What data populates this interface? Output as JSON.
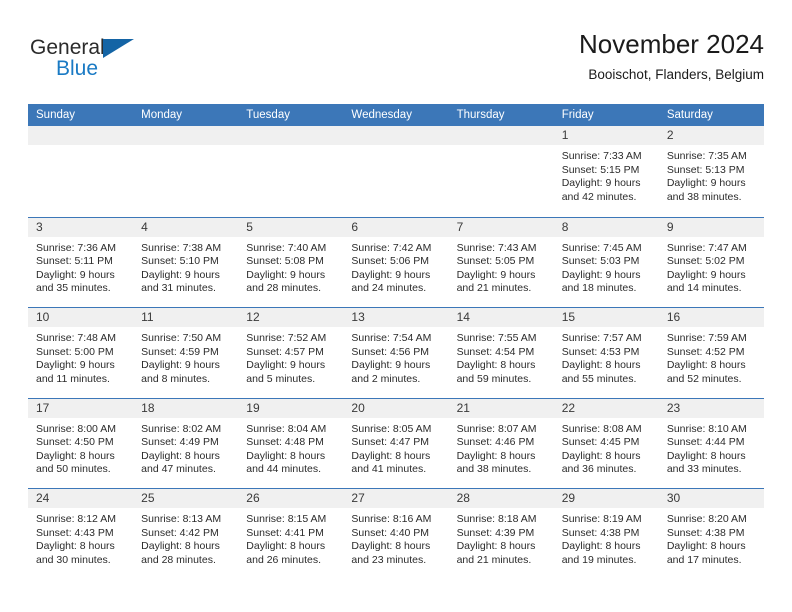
{
  "brand": {
    "name_part1": "General",
    "name_part2": "Blue",
    "triangle_color": "#1464a5",
    "blue_color": "#1a7ac4"
  },
  "header": {
    "title": "November 2024",
    "subtitle": "Booischot, Flanders, Belgium"
  },
  "theme": {
    "header_band": "#3c77b8",
    "daynum_band": "#f0f0f0",
    "row_divider": "#3c77b8",
    "text": "#2b2b2b"
  },
  "weekdays": [
    "Sunday",
    "Monday",
    "Tuesday",
    "Wednesday",
    "Thursday",
    "Friday",
    "Saturday"
  ],
  "weeks": [
    [
      {
        "day": "",
        "lines": []
      },
      {
        "day": "",
        "lines": []
      },
      {
        "day": "",
        "lines": []
      },
      {
        "day": "",
        "lines": []
      },
      {
        "day": "",
        "lines": []
      },
      {
        "day": "1",
        "lines": [
          "Sunrise: 7:33 AM",
          "Sunset: 5:15 PM",
          "Daylight: 9 hours",
          "and 42 minutes."
        ]
      },
      {
        "day": "2",
        "lines": [
          "Sunrise: 7:35 AM",
          "Sunset: 5:13 PM",
          "Daylight: 9 hours",
          "and 38 minutes."
        ]
      }
    ],
    [
      {
        "day": "3",
        "lines": [
          "Sunrise: 7:36 AM",
          "Sunset: 5:11 PM",
          "Daylight: 9 hours",
          "and 35 minutes."
        ]
      },
      {
        "day": "4",
        "lines": [
          "Sunrise: 7:38 AM",
          "Sunset: 5:10 PM",
          "Daylight: 9 hours",
          "and 31 minutes."
        ]
      },
      {
        "day": "5",
        "lines": [
          "Sunrise: 7:40 AM",
          "Sunset: 5:08 PM",
          "Daylight: 9 hours",
          "and 28 minutes."
        ]
      },
      {
        "day": "6",
        "lines": [
          "Sunrise: 7:42 AM",
          "Sunset: 5:06 PM",
          "Daylight: 9 hours",
          "and 24 minutes."
        ]
      },
      {
        "day": "7",
        "lines": [
          "Sunrise: 7:43 AM",
          "Sunset: 5:05 PM",
          "Daylight: 9 hours",
          "and 21 minutes."
        ]
      },
      {
        "day": "8",
        "lines": [
          "Sunrise: 7:45 AM",
          "Sunset: 5:03 PM",
          "Daylight: 9 hours",
          "and 18 minutes."
        ]
      },
      {
        "day": "9",
        "lines": [
          "Sunrise: 7:47 AM",
          "Sunset: 5:02 PM",
          "Daylight: 9 hours",
          "and 14 minutes."
        ]
      }
    ],
    [
      {
        "day": "10",
        "lines": [
          "Sunrise: 7:48 AM",
          "Sunset: 5:00 PM",
          "Daylight: 9 hours",
          "and 11 minutes."
        ]
      },
      {
        "day": "11",
        "lines": [
          "Sunrise: 7:50 AM",
          "Sunset: 4:59 PM",
          "Daylight: 9 hours",
          "and 8 minutes."
        ]
      },
      {
        "day": "12",
        "lines": [
          "Sunrise: 7:52 AM",
          "Sunset: 4:57 PM",
          "Daylight: 9 hours",
          "and 5 minutes."
        ]
      },
      {
        "day": "13",
        "lines": [
          "Sunrise: 7:54 AM",
          "Sunset: 4:56 PM",
          "Daylight: 9 hours",
          "and 2 minutes."
        ]
      },
      {
        "day": "14",
        "lines": [
          "Sunrise: 7:55 AM",
          "Sunset: 4:54 PM",
          "Daylight: 8 hours",
          "and 59 minutes."
        ]
      },
      {
        "day": "15",
        "lines": [
          "Sunrise: 7:57 AM",
          "Sunset: 4:53 PM",
          "Daylight: 8 hours",
          "and 55 minutes."
        ]
      },
      {
        "day": "16",
        "lines": [
          "Sunrise: 7:59 AM",
          "Sunset: 4:52 PM",
          "Daylight: 8 hours",
          "and 52 minutes."
        ]
      }
    ],
    [
      {
        "day": "17",
        "lines": [
          "Sunrise: 8:00 AM",
          "Sunset: 4:50 PM",
          "Daylight: 8 hours",
          "and 50 minutes."
        ]
      },
      {
        "day": "18",
        "lines": [
          "Sunrise: 8:02 AM",
          "Sunset: 4:49 PM",
          "Daylight: 8 hours",
          "and 47 minutes."
        ]
      },
      {
        "day": "19",
        "lines": [
          "Sunrise: 8:04 AM",
          "Sunset: 4:48 PM",
          "Daylight: 8 hours",
          "and 44 minutes."
        ]
      },
      {
        "day": "20",
        "lines": [
          "Sunrise: 8:05 AM",
          "Sunset: 4:47 PM",
          "Daylight: 8 hours",
          "and 41 minutes."
        ]
      },
      {
        "day": "21",
        "lines": [
          "Sunrise: 8:07 AM",
          "Sunset: 4:46 PM",
          "Daylight: 8 hours",
          "and 38 minutes."
        ]
      },
      {
        "day": "22",
        "lines": [
          "Sunrise: 8:08 AM",
          "Sunset: 4:45 PM",
          "Daylight: 8 hours",
          "and 36 minutes."
        ]
      },
      {
        "day": "23",
        "lines": [
          "Sunrise: 8:10 AM",
          "Sunset: 4:44 PM",
          "Daylight: 8 hours",
          "and 33 minutes."
        ]
      }
    ],
    [
      {
        "day": "24",
        "lines": [
          "Sunrise: 8:12 AM",
          "Sunset: 4:43 PM",
          "Daylight: 8 hours",
          "and 30 minutes."
        ]
      },
      {
        "day": "25",
        "lines": [
          "Sunrise: 8:13 AM",
          "Sunset: 4:42 PM",
          "Daylight: 8 hours",
          "and 28 minutes."
        ]
      },
      {
        "day": "26",
        "lines": [
          "Sunrise: 8:15 AM",
          "Sunset: 4:41 PM",
          "Daylight: 8 hours",
          "and 26 minutes."
        ]
      },
      {
        "day": "27",
        "lines": [
          "Sunrise: 8:16 AM",
          "Sunset: 4:40 PM",
          "Daylight: 8 hours",
          "and 23 minutes."
        ]
      },
      {
        "day": "28",
        "lines": [
          "Sunrise: 8:18 AM",
          "Sunset: 4:39 PM",
          "Daylight: 8 hours",
          "and 21 minutes."
        ]
      },
      {
        "day": "29",
        "lines": [
          "Sunrise: 8:19 AM",
          "Sunset: 4:38 PM",
          "Daylight: 8 hours",
          "and 19 minutes."
        ]
      },
      {
        "day": "30",
        "lines": [
          "Sunrise: 8:20 AM",
          "Sunset: 4:38 PM",
          "Daylight: 8 hours",
          "and 17 minutes."
        ]
      }
    ]
  ]
}
